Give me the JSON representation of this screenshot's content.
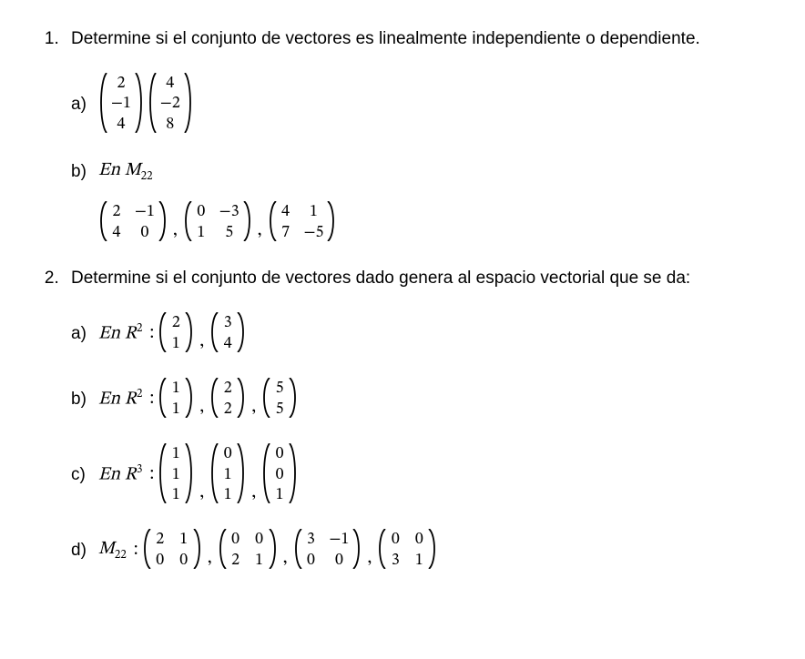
{
  "q1": {
    "text": "Determine si el conjunto de vectores es linealmente independiente o dependiente.",
    "a": {
      "label": "a)",
      "m1": [
        [
          "2"
        ],
        [
          "−1"
        ],
        [
          "4"
        ]
      ],
      "m2": [
        [
          "4"
        ],
        [
          "−2"
        ],
        [
          "8"
        ]
      ]
    },
    "b": {
      "label": "b)",
      "lead_pre": "En ",
      "lead_sym": "M",
      "lead_sub": "22",
      "m1": [
        [
          "2",
          "−1"
        ],
        [
          "4",
          "0"
        ]
      ],
      "m2": [
        [
          "0",
          "−3"
        ],
        [
          "1",
          "5"
        ]
      ],
      "m3": [
        [
          "4",
          "1"
        ],
        [
          "7",
          "−5"
        ]
      ]
    }
  },
  "q2": {
    "text": "Determine si el conjunto de vectores dado genera al espacio vectorial que se da:",
    "a": {
      "label": "a)",
      "lead_pre": "En ",
      "lead_sym": "R",
      "lead_sup": "2",
      "m1": [
        [
          "2"
        ],
        [
          "1"
        ]
      ],
      "m2": [
        [
          "3"
        ],
        [
          "4"
        ]
      ]
    },
    "b": {
      "label": "b)",
      "lead_pre": "En ",
      "lead_sym": "R",
      "lead_sup": "2",
      "m1": [
        [
          "1"
        ],
        [
          "1"
        ]
      ],
      "m2": [
        [
          "2"
        ],
        [
          "2"
        ]
      ],
      "m3": [
        [
          "5"
        ],
        [
          "5"
        ]
      ]
    },
    "c": {
      "label": "c)",
      "lead_pre": "En ",
      "lead_sym": "R",
      "lead_sup": "3",
      "m1": [
        [
          "1"
        ],
        [
          "1"
        ],
        [
          "1"
        ]
      ],
      "m2": [
        [
          "0"
        ],
        [
          "1"
        ],
        [
          "1"
        ]
      ],
      "m3": [
        [
          "0"
        ],
        [
          "0"
        ],
        [
          "1"
        ]
      ]
    },
    "d": {
      "label": "d)",
      "lead_sym": "M",
      "lead_sub": "22",
      "m1": [
        [
          "2",
          "1"
        ],
        [
          "0",
          "0"
        ]
      ],
      "m2": [
        [
          "0",
          "0"
        ],
        [
          "2",
          "1"
        ]
      ],
      "m3": [
        [
          "3",
          "−1"
        ],
        [
          "0",
          "0"
        ]
      ],
      "m4": [
        [
          "0",
          "0"
        ],
        [
          "3",
          "1"
        ]
      ]
    }
  }
}
